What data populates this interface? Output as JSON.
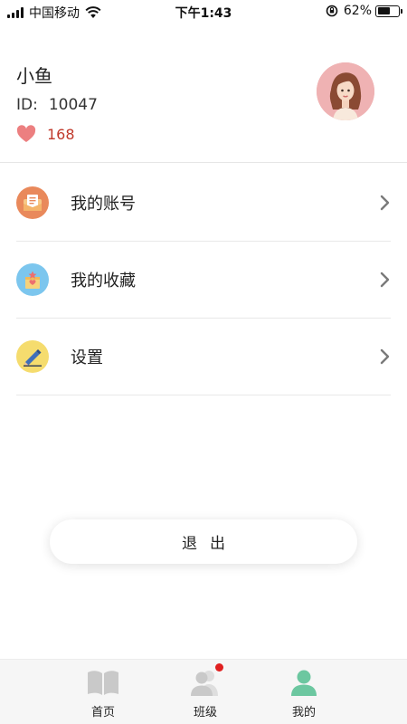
{
  "status_bar": {
    "carrier": "中国移动",
    "time": "下午1:43",
    "battery": "62%",
    "battery_level": 0.62
  },
  "profile": {
    "name": "小鱼",
    "id_label": "ID:",
    "id_value": "10047",
    "likes": "168",
    "avatar_icon": "woman-avatar-icon"
  },
  "menu": {
    "items": [
      {
        "label": "我的账号",
        "icon": "account-card-icon",
        "color": "#e9895b"
      },
      {
        "label": "我的收藏",
        "icon": "favorites-box-icon",
        "color": "#7cc6ee"
      },
      {
        "label": "设置",
        "icon": "settings-pencil-icon",
        "color": "#f5dc6e"
      }
    ]
  },
  "logout_label": "退出",
  "tabbar": {
    "tabs": [
      {
        "label": "首页",
        "icon": "book-icon"
      },
      {
        "label": "班级",
        "icon": "class-people-icon",
        "badge": true
      },
      {
        "label": "我的",
        "icon": "person-icon",
        "active": true
      }
    ],
    "active_color": "#6cc7a0",
    "inactive_color": "#c9c9c9"
  }
}
